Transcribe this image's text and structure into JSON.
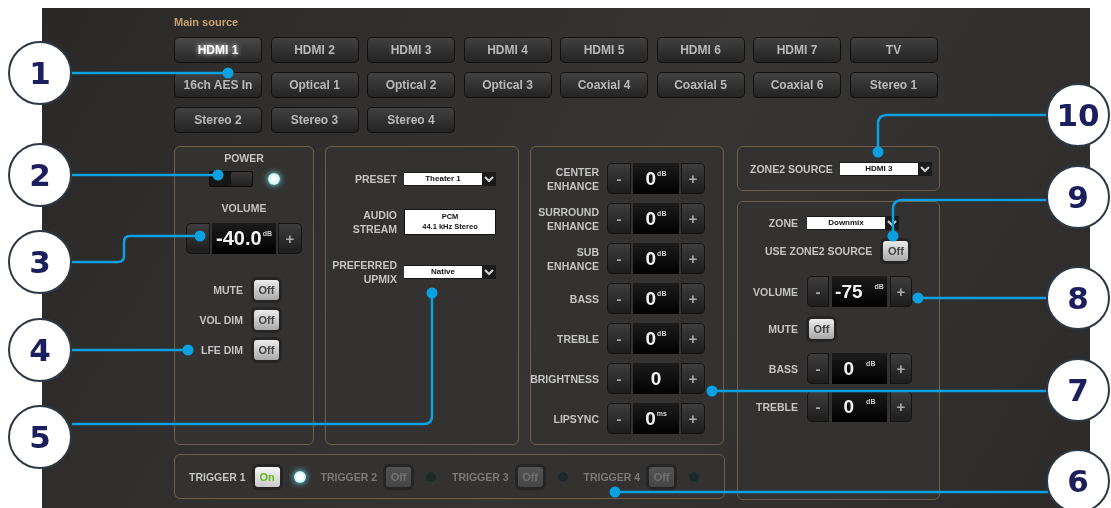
{
  "main_source": {
    "title": "Main source",
    "sources": [
      {
        "label": "HDMI 1",
        "selected": true
      },
      {
        "label": "HDMI 2",
        "selected": false
      },
      {
        "label": "HDMI 3",
        "selected": false
      },
      {
        "label": "HDMI 4",
        "selected": false
      },
      {
        "label": "HDMI 5",
        "selected": false
      },
      {
        "label": "HDMI 6",
        "selected": false
      },
      {
        "label": "HDMI 7",
        "selected": false
      },
      {
        "label": "TV",
        "selected": false
      },
      {
        "label": "16ch AES In",
        "selected": false
      },
      {
        "label": "Optical 1",
        "selected": false
      },
      {
        "label": "Optical 2",
        "selected": false
      },
      {
        "label": "Optical 3",
        "selected": false
      },
      {
        "label": "Coaxial 4",
        "selected": false
      },
      {
        "label": "Coaxial 5",
        "selected": false
      },
      {
        "label": "Coaxial 6",
        "selected": false
      },
      {
        "label": "Stereo 1",
        "selected": false
      },
      {
        "label": "Stereo 2",
        "selected": false
      },
      {
        "label": "Stereo 3",
        "selected": false
      },
      {
        "label": "Stereo 4",
        "selected": false
      }
    ]
  },
  "power_panel": {
    "power_label": "POWER",
    "power_on": true,
    "volume_label": "VOLUME",
    "volume": {
      "value": "-40.0",
      "unit": "dB",
      "plus": "+"
    },
    "toggles": [
      {
        "label": "MUTE",
        "value": "Off",
        "on": false
      },
      {
        "label": "VOL DIM",
        "value": "Off",
        "on": false
      },
      {
        "label": "LFE DIM",
        "value": "Off",
        "on": false
      }
    ]
  },
  "audio_panel": {
    "preset": {
      "label": "PRESET",
      "value": "Theater 1"
    },
    "audio_stream": {
      "label": "AUDIO STREAM",
      "lines": [
        "PCM",
        "44.1 kHz Stereo"
      ]
    },
    "preferred_upmix": {
      "label": "PREFERRED UPMIX",
      "value": "Native"
    }
  },
  "adjust_panel": {
    "rows": [
      {
        "label": "CENTER ENHANCE",
        "minus": "-",
        "value": "0",
        "unit": "dB",
        "plus": "+"
      },
      {
        "label": "SURROUND ENHANCE",
        "minus": "-",
        "value": "0",
        "unit": "dB",
        "plus": "+"
      },
      {
        "label": "SUB ENHANCE",
        "minus": "-",
        "value": "0",
        "unit": "dB",
        "plus": "+"
      },
      {
        "label": "BASS",
        "minus": "-",
        "value": "0",
        "unit": "dB",
        "plus": "+"
      },
      {
        "label": "TREBLE",
        "minus": "-",
        "value": "0",
        "unit": "dB",
        "plus": "+"
      },
      {
        "label": "BRIGHTNESS",
        "minus": "-",
        "value": "0",
        "plus": "+"
      },
      {
        "label": "LIPSYNC",
        "minus": "-",
        "value": "0",
        "unit": "ms",
        "plus": "+"
      }
    ]
  },
  "zone2_source": {
    "label": "ZONE2 SOURCE",
    "value": "HDMI 3"
  },
  "zone_panel": {
    "zone": {
      "label": "ZONE",
      "value": "Downmix"
    },
    "use_zone2_source": {
      "label": "USE ZONE2 SOURCE",
      "value": "Off",
      "on": false
    },
    "volume": {
      "label": "VOLUME",
      "minus": "-",
      "value": "-75",
      "unit": "dB",
      "plus": "+"
    },
    "mute": {
      "label": "MUTE",
      "value": "Off",
      "on": false
    },
    "bass": {
      "label": "BASS",
      "minus": "-",
      "value": "0",
      "unit": "dB",
      "plus": "+"
    },
    "treble": {
      "label": "TREBLE",
      "minus": "-",
      "value": "0",
      "unit": "dB",
      "plus": "+"
    }
  },
  "triggers": [
    {
      "label": "TRIGGER 1",
      "value": "On",
      "on": true,
      "disabled": false
    },
    {
      "label": "TRIGGER 2",
      "value": "Off",
      "on": false,
      "disabled": true
    },
    {
      "label": "TRIGGER 3",
      "value": "Off",
      "on": false,
      "disabled": true
    },
    {
      "label": "TRIGGER 4",
      "value": "Off",
      "on": false,
      "disabled": true
    }
  ],
  "callouts": [
    "1",
    "10",
    "2",
    "9",
    "3",
    "8",
    "4",
    "7",
    "5",
    "6"
  ]
}
